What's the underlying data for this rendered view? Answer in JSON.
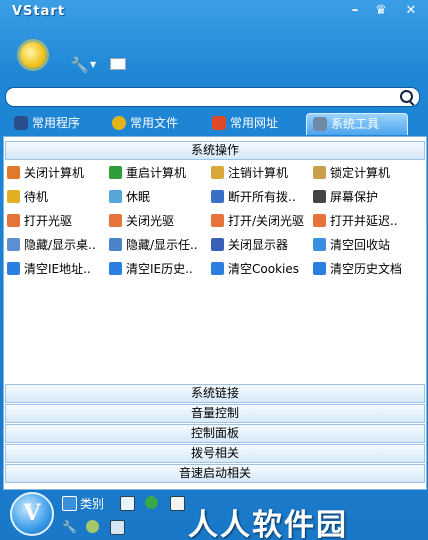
{
  "window": {
    "title": "VStart"
  },
  "colors": {
    "accent": "#1f86d6",
    "panel_header": "#d6e8f8",
    "brand_text": "#ffffff"
  },
  "search": {
    "placeholder": "",
    "value": ""
  },
  "tabs": [
    {
      "label": "常用程序",
      "icon": "program-icon",
      "active": false
    },
    {
      "label": "常用文件",
      "icon": "folder-icon",
      "active": false
    },
    {
      "label": "常用网址",
      "icon": "home-icon",
      "active": false
    },
    {
      "label": "系统工具",
      "icon": "system-tool-icon",
      "active": true
    }
  ],
  "sections": {
    "top": "系统操作",
    "bottom": [
      "系统链接",
      "音量控制",
      "控制面板",
      "拨号相关",
      "音速启动相关"
    ]
  },
  "items": [
    {
      "label": "关闭计算机",
      "icon": "power-icon"
    },
    {
      "label": "重启计算机",
      "icon": "restart-icon"
    },
    {
      "label": "注销计算机",
      "icon": "logoff-icon"
    },
    {
      "label": "锁定计算机",
      "icon": "lock-icon"
    },
    {
      "label": "待机",
      "icon": "standby-icon"
    },
    {
      "label": "休眠",
      "icon": "hibernate-icon"
    },
    {
      "label": "断开所有拨..",
      "icon": "disconnect-icon"
    },
    {
      "label": "屏幕保护",
      "icon": "screensaver-icon"
    },
    {
      "label": "打开光驱",
      "icon": "cd-open-icon"
    },
    {
      "label": "关闭光驱",
      "icon": "cd-close-icon"
    },
    {
      "label": "打开/关闭光驱",
      "icon": "cd-toggle-icon"
    },
    {
      "label": "打开并延迟..",
      "icon": "cd-delay-icon"
    },
    {
      "label": "隐藏/显示桌..",
      "icon": "desktop-toggle-icon"
    },
    {
      "label": "隐藏/显示任..",
      "icon": "taskbar-toggle-icon"
    },
    {
      "label": "关闭显示器",
      "icon": "monitor-off-icon"
    },
    {
      "label": "清空回收站",
      "icon": "recycle-bin-icon"
    },
    {
      "label": "清空IE地址..",
      "icon": "ie-address-icon"
    },
    {
      "label": "清空IE历史..",
      "icon": "ie-history-icon"
    },
    {
      "label": "清空Cookies",
      "icon": "cookies-icon"
    },
    {
      "label": "清空历史文档",
      "icon": "history-doc-icon"
    }
  ],
  "bottom_bar": {
    "logo_letter": "V",
    "category_label": "类别"
  },
  "watermark": "人人软件园"
}
